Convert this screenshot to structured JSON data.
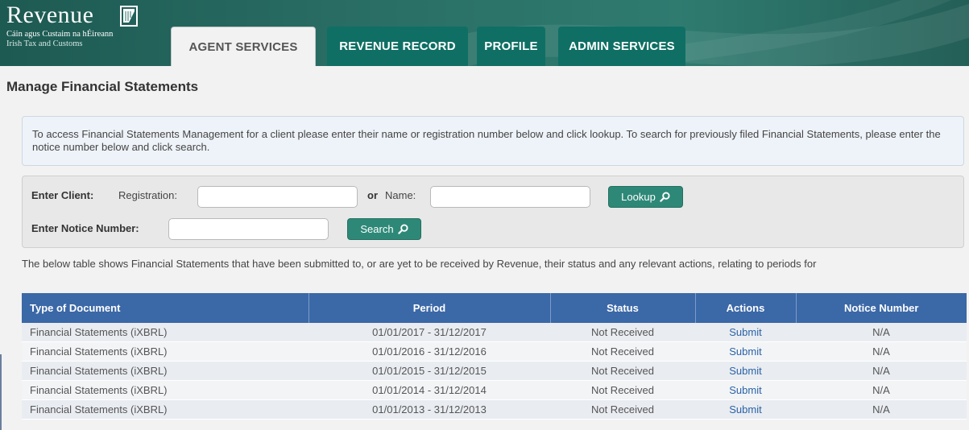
{
  "brand": {
    "name": "Revenue",
    "subtitle_irish": "Cáin agus Custaim na hÉireann",
    "subtitle_english": "Irish Tax and Customs"
  },
  "tabs": [
    {
      "label": "AGENT SERVICES",
      "active": true
    },
    {
      "label": "REVENUE RECORD",
      "active": false
    },
    {
      "label": "PROFILE",
      "active": false
    },
    {
      "label": "ADMIN SERVICES",
      "active": false
    }
  ],
  "page_title": "Manage Financial Statements",
  "info_text": "To access Financial Statements Management for a client please enter their name or registration number below and click lookup. To search for previously filed Financial Statements, please enter the notice number below and click search.",
  "search": {
    "enter_client_label": "Enter Client:",
    "registration_label": "Registration:",
    "registration_value": "",
    "or_label": "or",
    "name_label": "Name:",
    "name_value": "",
    "lookup_button": "Lookup",
    "enter_notice_label": "Enter Notice Number:",
    "notice_value": "",
    "search_button": "Search"
  },
  "table_description": "The below table shows Financial Statements that have been submitted to, or are yet to be received by Revenue, their status and any relevant actions, relating to periods for",
  "table": {
    "headers": [
      "Type of Document",
      "Period",
      "Status",
      "Actions",
      "Notice Number"
    ],
    "rows": [
      [
        "Financial Statements (iXBRL)",
        "01/01/2017 - 31/12/2017",
        "Not Received",
        "Submit",
        "N/A"
      ],
      [
        "Financial Statements (iXBRL)",
        "01/01/2016 - 31/12/2016",
        "Not Received",
        "Submit",
        "N/A"
      ],
      [
        "Financial Statements (iXBRL)",
        "01/01/2015 - 31/12/2015",
        "Not Received",
        "Submit",
        "N/A"
      ],
      [
        "Financial Statements (iXBRL)",
        "01/01/2014 - 31/12/2014",
        "Not Received",
        "Submit",
        "N/A"
      ],
      [
        "Financial Statements (iXBRL)",
        "01/01/2013 - 31/12/2013",
        "Not Received",
        "Submit",
        "N/A"
      ]
    ]
  },
  "colors": {
    "header_bg": "#2a6f66",
    "tab_dark": "#0f6f64",
    "button": "#2e8878",
    "table_header": "#3b68a7",
    "link": "#2a63a6"
  }
}
